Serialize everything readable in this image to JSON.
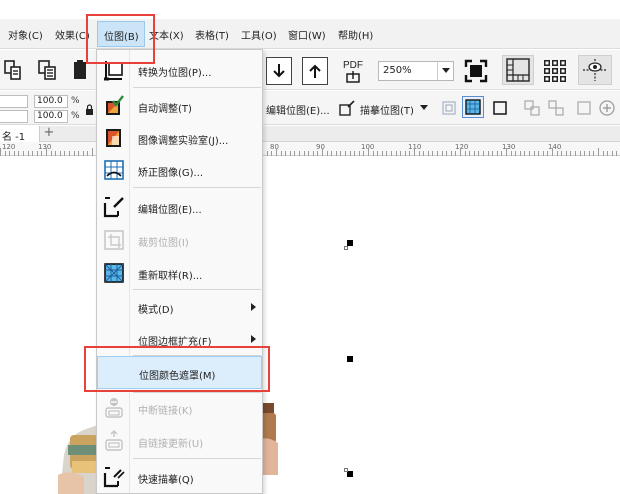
{
  "menubar": {
    "items": [
      {
        "label": "对象(C)"
      },
      {
        "label": "效果(C)"
      },
      {
        "label": "位图(B)"
      },
      {
        "label": "文本(X)"
      },
      {
        "label": "表格(T)"
      },
      {
        "label": "工具(O)"
      },
      {
        "label": "窗口(W)"
      },
      {
        "label": "帮助(H)"
      }
    ]
  },
  "toolbar": {
    "pdf_label": "PDF",
    "zoom_value": "250%"
  },
  "property_bar": {
    "width_percent": "100.0",
    "height_percent": "100.0",
    "percent_unit": "%",
    "edit_bitmap_label": "编辑位图(E)...",
    "trace_bitmap_label": "描摹位图(T)"
  },
  "document": {
    "tab_label": "名 -1",
    "add_tab": "+"
  },
  "ruler": {
    "labels": [
      "120",
      "130",
      "80",
      "90",
      "100",
      "110",
      "120",
      "130",
      "140"
    ]
  },
  "context_menu": {
    "items": [
      {
        "label": "转换为位图(P)...",
        "icon": "convert-to-bitmap-icon",
        "disabled": false
      },
      {
        "label": "自动调整(T)",
        "icon": "auto-adjust-icon",
        "disabled": false
      },
      {
        "label": "图像调整实验室(J)...",
        "icon": "image-adjustment-lab-icon",
        "disabled": false
      },
      {
        "label": "矫正图像(G)...",
        "icon": "straighten-image-icon",
        "disabled": false
      },
      {
        "label": "编辑位图(E)...",
        "icon": "edit-bitmap-icon",
        "disabled": false
      },
      {
        "label": "裁剪位图(I)",
        "icon": "crop-bitmap-icon",
        "disabled": true
      },
      {
        "label": "重新取样(R)...",
        "icon": "resample-icon",
        "disabled": false
      },
      {
        "label": "模式(D)",
        "icon": "",
        "disabled": false
      },
      {
        "label": "位图边框扩充(F)",
        "icon": "",
        "disabled": false
      },
      {
        "label": "位图颜色遮罩(M)",
        "icon": "",
        "disabled": false
      },
      {
        "label": "中断链接(K)",
        "icon": "break-link-icon",
        "disabled": true
      },
      {
        "label": "自链接更新(U)",
        "icon": "update-link-icon",
        "disabled": true
      },
      {
        "label": "快速描摹(Q)",
        "icon": "quick-trace-icon",
        "disabled": false
      }
    ]
  },
  "colors": {
    "highlight_border": "#e8413a",
    "hover_fill": "#dcedfb",
    "active_menu_fill": "#cce4f7",
    "icon_blue": "#1f6fb5"
  }
}
